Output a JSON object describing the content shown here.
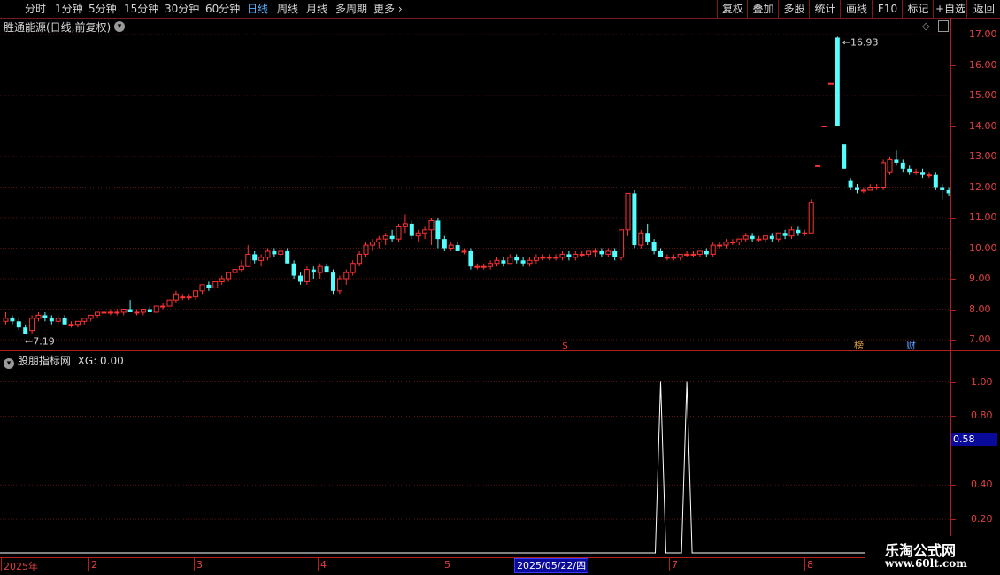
{
  "toolbar": {
    "periods": [
      "分时",
      "1分钟",
      "5分钟",
      "15分钟",
      "30分钟",
      "60分钟",
      "日线",
      "周线",
      "月线",
      "多周期",
      "更多"
    ],
    "active_period": "日线",
    "right_buttons": [
      "复权",
      "叠加",
      "多股",
      "统计",
      "画线",
      "F10",
      "标记",
      "+自选",
      "返回"
    ]
  },
  "main_panel": {
    "title": "胜通能源(日线,前复权)",
    "high_label": "16.93",
    "low_label": "7.19",
    "y_ticks": [
      "17.00",
      "16.00",
      "15.00",
      "14.00",
      "13.00",
      "12.00",
      "11.00",
      "10.00",
      "9.00",
      "8.00",
      "7.00"
    ],
    "markers": {
      "dollar": "$",
      "bang": "榜",
      "cai": "财"
    }
  },
  "sub_panel": {
    "title": "股朋指标网",
    "indicator_label": "XG: 0.00",
    "y_ticks": [
      "1.00",
      "0.80",
      "0.40",
      "0.20"
    ],
    "current_value": "0.58"
  },
  "x_axis": {
    "labels": [
      "2025年",
      "2",
      "3",
      "4",
      "5",
      "7",
      "8"
    ],
    "cursor_date": "2025/05/22/四"
  },
  "watermark": {
    "line1": "乐淘公式网",
    "line2": "www.60lt.com"
  },
  "colors": {
    "up": "#ff3333",
    "down": "#54ffff",
    "axis": "#b02020",
    "active": "#5ab0ff"
  },
  "chart_data": {
    "type": "candlestick",
    "price_range": [
      6.8,
      17.3
    ],
    "candles": [
      [
        7.6,
        7.9,
        7.5,
        7.7
      ],
      [
        7.7,
        7.8,
        7.5,
        7.6
      ],
      [
        7.6,
        7.7,
        7.3,
        7.4
      ],
      [
        7.4,
        7.5,
        7.2,
        7.2
      ],
      [
        7.3,
        7.8,
        7.2,
        7.7
      ],
      [
        7.7,
        7.9,
        7.6,
        7.8
      ],
      [
        7.8,
        7.9,
        7.6,
        7.7
      ],
      [
        7.7,
        7.8,
        7.5,
        7.6
      ],
      [
        7.6,
        7.8,
        7.5,
        7.7
      ],
      [
        7.7,
        7.8,
        7.5,
        7.5
      ],
      [
        7.5,
        7.6,
        7.4,
        7.5
      ],
      [
        7.5,
        7.6,
        7.4,
        7.6
      ],
      [
        7.6,
        7.7,
        7.5,
        7.7
      ],
      [
        7.7,
        7.8,
        7.6,
        7.8
      ],
      [
        7.8,
        7.9,
        7.7,
        7.9
      ],
      [
        7.9,
        8.0,
        7.8,
        7.9
      ],
      [
        7.9,
        8.0,
        7.8,
        7.9
      ],
      [
        7.9,
        8.0,
        7.8,
        7.9
      ],
      [
        7.9,
        8.0,
        7.8,
        8.0
      ],
      [
        8.0,
        8.3,
        7.9,
        7.9
      ],
      [
        7.9,
        8.0,
        7.8,
        7.9
      ],
      [
        7.9,
        8.0,
        7.8,
        8.0
      ],
      [
        8.0,
        8.1,
        7.9,
        7.9
      ],
      [
        7.9,
        8.1,
        7.9,
        8.1
      ],
      [
        8.1,
        8.2,
        8.0,
        8.1
      ],
      [
        8.1,
        8.3,
        8.1,
        8.3
      ],
      [
        8.3,
        8.6,
        8.2,
        8.5
      ],
      [
        8.4,
        8.5,
        8.3,
        8.4
      ],
      [
        8.4,
        8.5,
        8.3,
        8.4
      ],
      [
        8.4,
        8.6,
        8.3,
        8.6
      ],
      [
        8.6,
        8.8,
        8.5,
        8.8
      ],
      [
        8.8,
        8.9,
        8.6,
        8.7
      ],
      [
        8.7,
        8.9,
        8.7,
        8.9
      ],
      [
        8.9,
        9.1,
        8.8,
        9.0
      ],
      [
        9.0,
        9.2,
        8.9,
        9.2
      ],
      [
        9.2,
        9.3,
        9.0,
        9.3
      ],
      [
        9.3,
        9.6,
        9.2,
        9.4
      ],
      [
        9.4,
        10.1,
        9.4,
        9.8
      ],
      [
        9.8,
        9.9,
        9.5,
        9.6
      ],
      [
        9.6,
        9.8,
        9.4,
        9.7
      ],
      [
        9.7,
        10.0,
        9.6,
        9.9
      ],
      [
        9.9,
        10.0,
        9.7,
        9.8
      ],
      [
        9.8,
        10.0,
        9.7,
        9.9
      ],
      [
        9.9,
        10.0,
        9.5,
        9.5
      ],
      [
        9.5,
        9.6,
        9.0,
        9.1
      ],
      [
        9.1,
        9.2,
        8.8,
        8.9
      ],
      [
        8.9,
        9.4,
        8.8,
        9.3
      ],
      [
        9.3,
        9.4,
        9.0,
        9.2
      ],
      [
        9.2,
        9.5,
        9.0,
        9.4
      ],
      [
        9.4,
        9.5,
        9.2,
        9.2
      ],
      [
        9.2,
        9.3,
        8.5,
        8.6
      ],
      [
        8.6,
        9.1,
        8.5,
        9.0
      ],
      [
        9.0,
        9.3,
        8.8,
        9.2
      ],
      [
        9.2,
        9.6,
        9.1,
        9.5
      ],
      [
        9.5,
        9.9,
        9.4,
        9.8
      ],
      [
        9.8,
        10.2,
        9.7,
        10.1
      ],
      [
        10.1,
        10.3,
        9.9,
        10.2
      ],
      [
        10.2,
        10.4,
        10.0,
        10.3
      ],
      [
        10.3,
        10.5,
        10.1,
        10.4
      ],
      [
        10.4,
        10.6,
        10.2,
        10.3
      ],
      [
        10.3,
        10.8,
        10.2,
        10.7
      ],
      [
        10.7,
        11.1,
        10.5,
        10.8
      ],
      [
        10.8,
        10.9,
        10.3,
        10.4
      ],
      [
        10.4,
        10.6,
        10.2,
        10.5
      ],
      [
        10.5,
        10.7,
        10.3,
        10.6
      ],
      [
        10.6,
        11.0,
        10.1,
        10.9
      ],
      [
        10.9,
        11.0,
        10.0,
        10.3
      ],
      [
        10.3,
        10.4,
        9.9,
        10.0
      ],
      [
        10.0,
        10.2,
        9.9,
        10.1
      ],
      [
        10.1,
        10.2,
        9.9,
        9.9
      ],
      [
        9.9,
        10.0,
        9.8,
        9.9
      ],
      [
        9.9,
        10.0,
        9.3,
        9.4
      ],
      [
        9.4,
        9.5,
        9.3,
        9.4
      ],
      [
        9.4,
        9.5,
        9.3,
        9.4
      ],
      [
        9.4,
        9.6,
        9.3,
        9.5
      ],
      [
        9.5,
        9.7,
        9.4,
        9.6
      ],
      [
        9.6,
        9.7,
        9.4,
        9.5
      ],
      [
        9.5,
        9.8,
        9.5,
        9.7
      ],
      [
        9.7,
        9.8,
        9.5,
        9.6
      ],
      [
        9.6,
        9.7,
        9.4,
        9.5
      ],
      [
        9.5,
        9.7,
        9.4,
        9.6
      ],
      [
        9.6,
        9.8,
        9.5,
        9.7
      ],
      [
        9.7,
        9.8,
        9.6,
        9.7
      ],
      [
        9.7,
        9.8,
        9.6,
        9.7
      ],
      [
        9.7,
        9.8,
        9.6,
        9.7
      ],
      [
        9.7,
        9.9,
        9.6,
        9.8
      ],
      [
        9.8,
        9.9,
        9.6,
        9.7
      ],
      [
        9.7,
        9.9,
        9.6,
        9.8
      ],
      [
        9.8,
        9.9,
        9.7,
        9.8
      ],
      [
        9.8,
        9.9,
        9.7,
        9.9
      ],
      [
        9.9,
        10.0,
        9.7,
        9.9
      ],
      [
        9.9,
        10.0,
        9.7,
        9.8
      ],
      [
        9.8,
        10.0,
        9.7,
        9.9
      ],
      [
        9.9,
        10.0,
        9.6,
        9.7
      ],
      [
        9.7,
        10.6,
        9.6,
        10.6
      ],
      [
        10.6,
        11.8,
        10.4,
        11.8
      ],
      [
        11.8,
        11.9,
        10.0,
        10.1
      ],
      [
        10.1,
        10.6,
        10.0,
        10.5
      ],
      [
        10.5,
        10.8,
        10.1,
        10.2
      ],
      [
        10.2,
        10.3,
        9.8,
        9.9
      ],
      [
        9.9,
        10.0,
        9.7,
        9.7
      ],
      [
        9.7,
        9.8,
        9.6,
        9.7
      ],
      [
        9.7,
        9.8,
        9.6,
        9.7
      ],
      [
        9.7,
        9.8,
        9.6,
        9.8
      ],
      [
        9.8,
        9.9,
        9.7,
        9.8
      ],
      [
        9.8,
        9.9,
        9.7,
        9.8
      ],
      [
        9.8,
        9.9,
        9.7,
        9.9
      ],
      [
        9.9,
        10.0,
        9.7,
        9.8
      ],
      [
        9.8,
        10.2,
        9.7,
        10.1
      ],
      [
        10.1,
        10.2,
        10.0,
        10.1
      ],
      [
        10.1,
        10.3,
        10.0,
        10.2
      ],
      [
        10.2,
        10.3,
        10.1,
        10.2
      ],
      [
        10.2,
        10.3,
        10.1,
        10.3
      ],
      [
        10.3,
        10.5,
        10.2,
        10.4
      ],
      [
        10.4,
        10.5,
        10.2,
        10.3
      ],
      [
        10.3,
        10.4,
        10.2,
        10.3
      ],
      [
        10.3,
        10.4,
        10.2,
        10.4
      ],
      [
        10.4,
        10.5,
        10.2,
        10.3
      ],
      [
        10.3,
        10.5,
        10.2,
        10.5
      ],
      [
        10.5,
        10.6,
        10.3,
        10.4
      ],
      [
        10.4,
        10.7,
        10.3,
        10.6
      ],
      [
        10.6,
        10.7,
        10.4,
        10.5
      ],
      [
        10.5,
        10.6,
        10.4,
        10.5
      ],
      [
        10.5,
        11.6,
        10.5,
        11.5
      ],
      [
        12.7,
        12.7,
        12.7,
        12.7
      ],
      [
        14.0,
        14.0,
        14.0,
        14.0
      ],
      [
        15.4,
        15.4,
        15.4,
        15.4
      ],
      [
        16.9,
        16.93,
        14.0,
        14.0
      ],
      [
        13.4,
        13.4,
        12.6,
        12.6
      ],
      [
        12.2,
        12.3,
        11.9,
        12.0
      ],
      [
        12.0,
        12.1,
        11.8,
        11.9
      ],
      [
        11.9,
        12.0,
        11.8,
        11.9
      ],
      [
        11.9,
        12.1,
        11.9,
        12.0
      ],
      [
        12.0,
        12.1,
        11.9,
        12.0
      ],
      [
        12.0,
        12.9,
        11.9,
        12.8
      ],
      [
        12.5,
        13.0,
        12.4,
        12.9
      ],
      [
        12.9,
        13.2,
        12.7,
        12.8
      ],
      [
        12.8,
        12.9,
        12.5,
        12.6
      ],
      [
        12.6,
        12.7,
        12.4,
        12.5
      ],
      [
        12.5,
        12.6,
        12.4,
        12.5
      ],
      [
        12.5,
        12.6,
        12.3,
        12.4
      ],
      [
        12.4,
        12.5,
        12.3,
        12.4
      ],
      [
        12.4,
        12.5,
        11.9,
        12.0
      ],
      [
        12.0,
        12.1,
        11.6,
        11.9
      ],
      [
        11.9,
        12.0,
        11.7,
        11.8
      ],
      [
        11.8,
        12.0,
        11.7,
        11.9
      ],
      [
        11.9,
        12.1,
        11.8,
        12.0
      ],
      [
        12.0,
        12.1,
        11.6,
        11.7
      ],
      [
        11.7,
        11.8,
        11.5,
        11.6
      ]
    ],
    "indicator": {
      "name": "XG",
      "spikes_at_candle": [
        100,
        104
      ],
      "ylim": [
        0,
        1.08
      ]
    }
  }
}
